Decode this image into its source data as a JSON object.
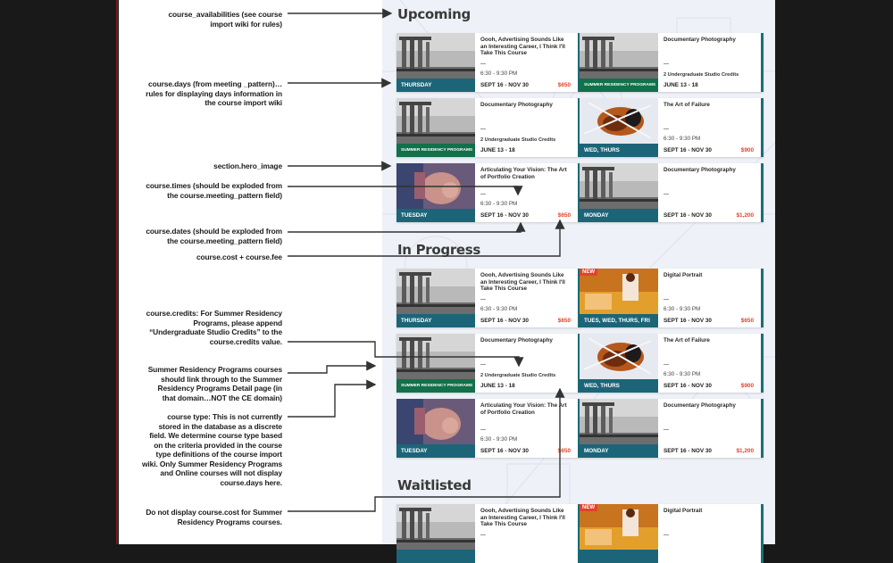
{
  "annotations": [
    {
      "name": "note-course-availabilities",
      "lines": [
        "course_availabilities (see course",
        "import wiki for rules)"
      ]
    },
    {
      "name": "note-course-days",
      "lines": [
        "course.days (from meeting _pattern)…",
        "rules for displaying days information in",
        "the course import wiki"
      ]
    },
    {
      "name": "note-hero-image",
      "lines": [
        "section.hero_image"
      ]
    },
    {
      "name": "note-course-times",
      "lines": [
        "course.times (should be exploded from",
        "the course.meeting_pattern field)"
      ]
    },
    {
      "name": "note-course-dates",
      "lines": [
        "course.dates (should be exploded from",
        "the course.meeting_pattern field)"
      ]
    },
    {
      "name": "note-course-cost",
      "lines": [
        "course.cost + course.fee"
      ]
    },
    {
      "name": "note-course-credits",
      "lines": [
        "course.credits: For Summer Residency",
        "Programs, please append",
        "“Undergraduate Studio Credits” to the",
        "course.credits value."
      ]
    },
    {
      "name": "note-summer-residency-link",
      "lines": [
        "Summer Residency Programs courses",
        "should link through to the Summer",
        "Residency Programs Detail page (in",
        "that domain…NOT the CE domain)"
      ]
    },
    {
      "name": "note-course-type",
      "lines": [
        "course type: This is not currently",
        "stored in the database as a discrete",
        "field. We determine course type based",
        "on the criteria provided in the course",
        "type definitions of the course import",
        "wiki. Only Summer Residency Programs",
        "and Online courses will not display",
        "course.days here."
      ]
    },
    {
      "name": "note-no-cost",
      "lines": [
        "Do not display course.cost for Summer",
        "Residency Programs courses."
      ]
    }
  ],
  "sections": [
    {
      "title": "Upcoming",
      "cards": [
        {
          "title": "Oooh, Advertising Sounds Like an Interesting Career, I Think I'll Take This Course",
          "photo": "columns",
          "day_bar": "THURSDAY",
          "bar_type": "teal",
          "times": "6:30 - 9:30 PM",
          "credits": "",
          "dates": "SEPT 16 - NOV 30",
          "price": "$650",
          "badge": ""
        },
        {
          "title": "Documentary Photography",
          "photo": "columns",
          "day_bar": "SUMMER RESIDENCY PROGRAMS",
          "bar_type": "green",
          "times": "",
          "credits": "2 Undergraduate Studio Credits",
          "dates": "JUNE 13 - 18",
          "price": "",
          "badge": ""
        },
        {
          "title": "Documentary Photography",
          "photo": "columns",
          "day_bar": "SUMMER RESIDENCY PROGRAMS",
          "bar_type": "green",
          "times": "",
          "credits": "2 Undergraduate Studio Credits",
          "dates": "JUNE 13 - 18",
          "price": "",
          "badge": ""
        },
        {
          "title": "The Art of Failure",
          "photo": "fur",
          "day_bar": "WED, THURS",
          "bar_type": "teal",
          "times": "6:30 - 9:30 PM",
          "credits": "",
          "dates": "SEPT 16 - NOV 30",
          "price": "$900",
          "badge": ""
        },
        {
          "title": "Articulating Your Vision: The Art of Portfolio Creation",
          "photo": "hands",
          "day_bar": "TUESDAY",
          "bar_type": "teal",
          "times": "6:30 - 9:30 PM",
          "credits": "",
          "dates": "SEPT 16 - NOV 30",
          "price": "$650",
          "badge": ""
        },
        {
          "title": "Documentary Photography",
          "photo": "columns",
          "day_bar": "MONDAY",
          "bar_type": "teal",
          "times": "",
          "credits": "",
          "dates": "SEPT 16 - NOV 30",
          "price": "$1,200",
          "badge": ""
        }
      ]
    },
    {
      "title": "In Progress",
      "cards": [
        {
          "title": "Oooh, Advertising Sounds Like an Interesting Career, I Think I'll Take This Course",
          "photo": "columns",
          "day_bar": "THURSDAY",
          "bar_type": "teal",
          "times": "6:30 - 9:30 PM",
          "credits": "",
          "dates": "SEPT 16 - NOV 30",
          "price": "$650",
          "badge": ""
        },
        {
          "title": "Digital Portrait",
          "photo": "portrait",
          "day_bar": "TUES, WED, THURS, FRI",
          "bar_type": "teal",
          "times": "6:30 - 9:30 PM",
          "credits": "",
          "dates": "SEPT 16 - NOV 30",
          "price": "$650",
          "badge": "NEW"
        },
        {
          "title": "Documentary Photography",
          "photo": "columns",
          "day_bar": "SUMMER RESIDENCY PROGRAMS",
          "bar_type": "green",
          "times": "",
          "credits": "2 Undergraduate Studio Credits",
          "dates": "JUNE 13 - 18",
          "price": "",
          "badge": ""
        },
        {
          "title": "The Art of Failure",
          "photo": "fur",
          "day_bar": "WED, THURS",
          "bar_type": "teal",
          "times": "6:30 - 9:30 PM",
          "credits": "",
          "dates": "SEPT 16 - NOV 30",
          "price": "$900",
          "badge": ""
        },
        {
          "title": "Articulating Your Vision: The Art of Portfolio Creation",
          "photo": "hands",
          "day_bar": "TUESDAY",
          "bar_type": "teal",
          "times": "6:30 - 9:30 PM",
          "credits": "",
          "dates": "SEPT 16 - NOV 30",
          "price": "$650",
          "badge": ""
        },
        {
          "title": "Documentary Photography",
          "photo": "columns",
          "day_bar": "MONDAY",
          "bar_type": "teal",
          "times": "",
          "credits": "",
          "dates": "SEPT 16 - NOV 30",
          "price": "$1,200",
          "badge": ""
        }
      ]
    },
    {
      "title": "Waitlisted",
      "cards": [
        {
          "title": "Oooh, Advertising Sounds Like an Interesting Career, I Think I'll Take This Course",
          "photo": "columns",
          "day_bar": "",
          "bar_type": "teal",
          "times": "",
          "credits": "",
          "dates": "",
          "price": "",
          "badge": ""
        },
        {
          "title": "Digital Portrait",
          "photo": "portrait",
          "day_bar": "",
          "bar_type": "teal",
          "times": "",
          "credits": "",
          "dates": "",
          "price": "",
          "badge": "NEW"
        }
      ]
    }
  ],
  "colors": {
    "teal_bar": "#1c6578",
    "green_bar": "#12704a",
    "price": "#e2432a",
    "card_border": "#1c6e78"
  }
}
